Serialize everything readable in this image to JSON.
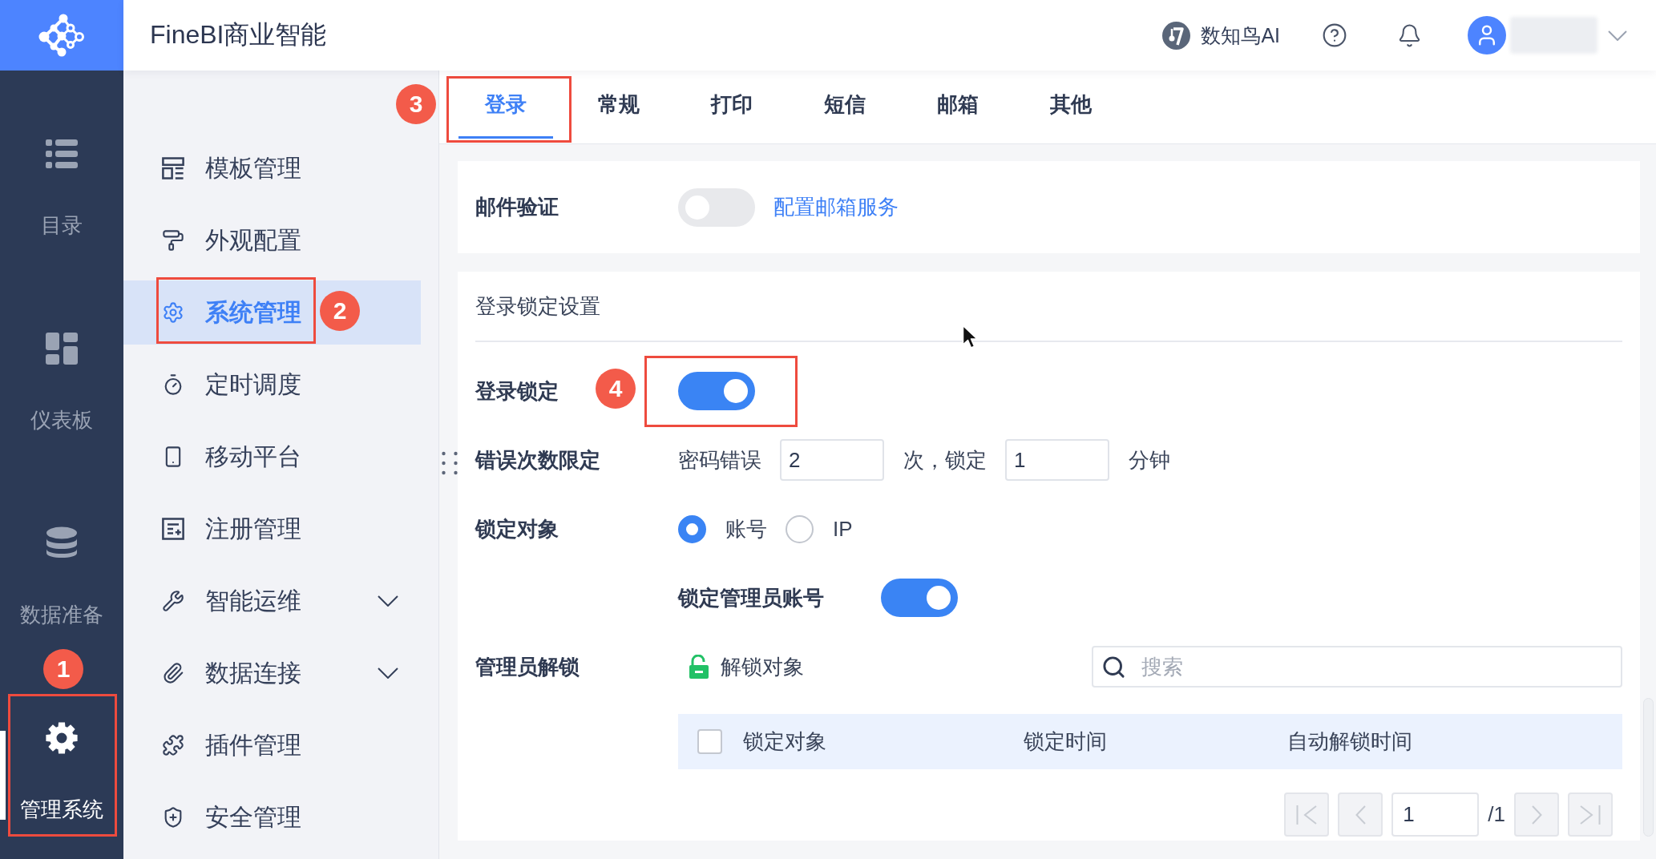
{
  "header": {
    "title": "FineBI商业智能",
    "ai_assistant": "数知鸟AI"
  },
  "rail": {
    "items": [
      {
        "label": "目录",
        "kind": "list",
        "selected": false,
        "highlighted": false
      },
      {
        "label": "仪表板",
        "kind": "dashboard",
        "selected": false,
        "highlighted": false
      },
      {
        "label": "数据准备",
        "kind": "database",
        "selected": false,
        "highlighted": false
      },
      {
        "label": "管理系统",
        "kind": "settings",
        "selected": true,
        "highlighted": true,
        "callout": "1"
      }
    ]
  },
  "submenu": {
    "items": [
      {
        "label": "模板管理",
        "kind": "template",
        "selected": false,
        "highlighted": false
      },
      {
        "label": "外观配置",
        "kind": "appearance",
        "selected": false,
        "highlighted": false
      },
      {
        "label": "系统管理",
        "kind": "system",
        "selected": true,
        "highlighted": true,
        "callout": "2"
      },
      {
        "label": "定时调度",
        "kind": "schedule",
        "selected": false,
        "highlighted": false
      },
      {
        "label": "移动平台",
        "kind": "mobile",
        "selected": false,
        "highlighted": false
      },
      {
        "label": "注册管理",
        "kind": "registration",
        "selected": false,
        "highlighted": false
      },
      {
        "label": "智能运维",
        "kind": "operations",
        "selected": false,
        "highlighted": false,
        "expanded": false
      },
      {
        "label": "数据连接",
        "kind": "connection",
        "selected": false,
        "highlighted": false,
        "expanded": false
      },
      {
        "label": "插件管理",
        "kind": "plugin",
        "selected": false,
        "highlighted": false
      },
      {
        "label": "安全管理",
        "kind": "security",
        "selected": false,
        "highlighted": false
      }
    ]
  },
  "tabs": [
    {
      "label": "登录",
      "selected": true,
      "highlighted": true,
      "callout": "3"
    },
    {
      "label": "常规",
      "selected": false,
      "highlighted": false
    },
    {
      "label": "打印",
      "selected": false,
      "highlighted": false
    },
    {
      "label": "短信",
      "selected": false,
      "highlighted": false
    },
    {
      "label": "邮箱",
      "selected": false,
      "highlighted": false
    },
    {
      "label": "其他",
      "selected": false,
      "highlighted": false
    }
  ],
  "email_verification": {
    "label": "邮件验证",
    "on": false,
    "link": "配置邮箱服务"
  },
  "login_lock": {
    "title": "登录锁定设置",
    "lock": {
      "label": "登录锁定",
      "on": true,
      "highlighted": true,
      "callout": "4"
    },
    "error_limit": {
      "label": "错误次数限定",
      "prefix": "密码错误",
      "attempts": "2",
      "middle": "次，锁定",
      "minutes": "1",
      "suffix": "分钟"
    },
    "lock_target": {
      "label": "锁定对象",
      "options": [
        {
          "label": "账号",
          "selected": true
        },
        {
          "label": "IP",
          "selected": false
        }
      ]
    },
    "lock_admin": {
      "label": "锁定管理员账号",
      "on": true
    },
    "admin_unlock": {
      "label": "管理员解锁",
      "action": "解锁对象",
      "search": {
        "placeholder": "搜索"
      },
      "table": {
        "select_all_checked": false,
        "columns": [
          "锁定对象",
          "锁定时间",
          "自动解锁时间"
        ]
      },
      "pagination": {
        "page": "1",
        "total": "/1",
        "buttons": [
          {
            "kind": "first",
            "disabled": true
          },
          {
            "kind": "prev",
            "disabled": true
          },
          {
            "kind": "next",
            "disabled": true
          },
          {
            "kind": "last",
            "disabled": true
          }
        ]
      }
    }
  }
}
